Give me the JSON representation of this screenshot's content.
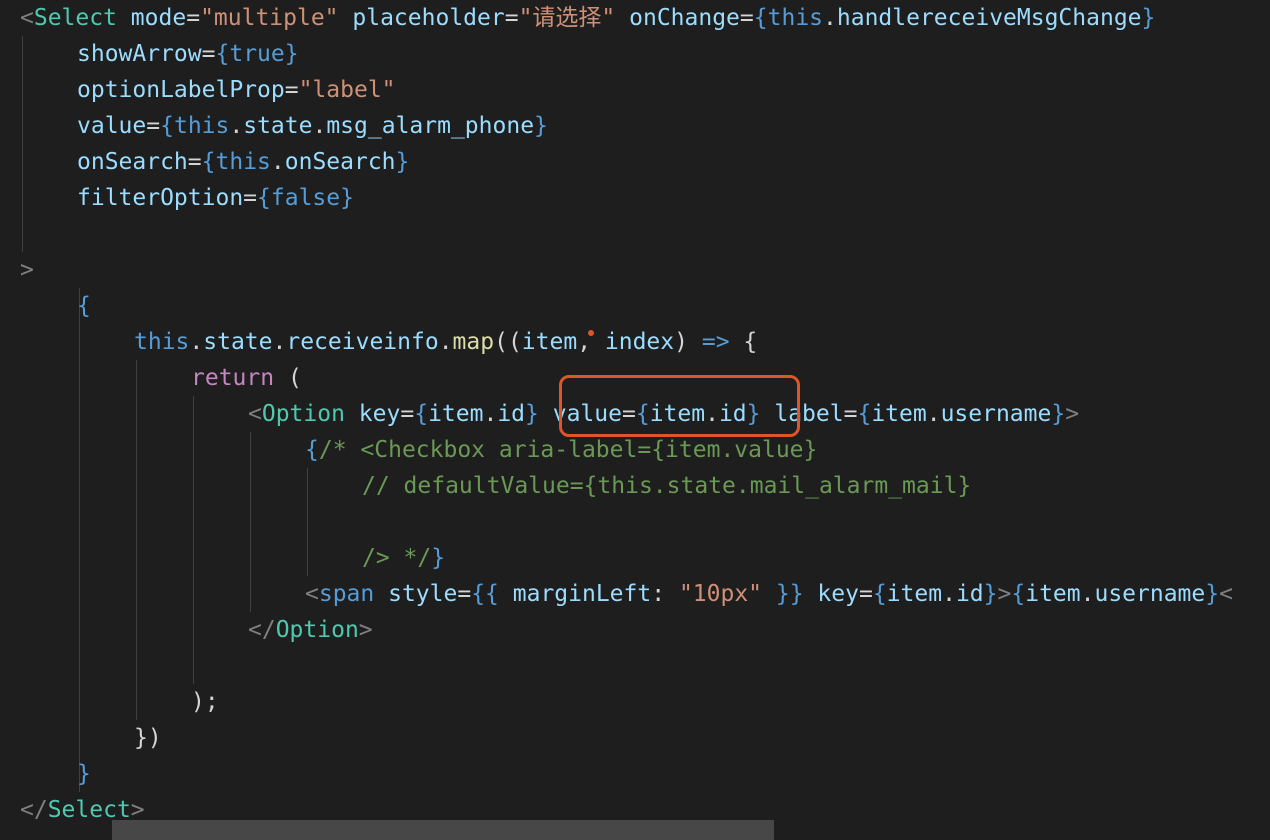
{
  "editor": {
    "lines": [
      {
        "indent": 0,
        "tokens": [
          {
            "t": "<",
            "c": "t-punct"
          },
          {
            "t": "Select",
            "c": "t-tag"
          },
          {
            "t": " mode",
            "c": "t-attr"
          },
          {
            "t": "=",
            "c": "t-op"
          },
          {
            "t": "\"multiple\"",
            "c": "t-str"
          },
          {
            "t": " placeholder",
            "c": "t-attr"
          },
          {
            "t": "=",
            "c": "t-op"
          },
          {
            "t": "\"请选择\"",
            "c": "t-str"
          },
          {
            "t": " onChange",
            "c": "t-attr"
          },
          {
            "t": "=",
            "c": "t-op"
          },
          {
            "t": "{",
            "c": "t-brace"
          },
          {
            "t": "this",
            "c": "t-kw"
          },
          {
            "t": ".",
            "c": "t-text"
          },
          {
            "t": "handlereceiveMsgChange",
            "c": "t-var"
          },
          {
            "t": "}",
            "c": "t-brace"
          }
        ]
      },
      {
        "indent": 1,
        "tokens": [
          {
            "t": "showArrow",
            "c": "t-attr"
          },
          {
            "t": "=",
            "c": "t-op"
          },
          {
            "t": "{",
            "c": "t-brace"
          },
          {
            "t": "true",
            "c": "t-kw"
          },
          {
            "t": "}",
            "c": "t-brace"
          }
        ]
      },
      {
        "indent": 1,
        "tokens": [
          {
            "t": "optionLabelProp",
            "c": "t-attr"
          },
          {
            "t": "=",
            "c": "t-op"
          },
          {
            "t": "\"label\"",
            "c": "t-str"
          }
        ]
      },
      {
        "indent": 1,
        "tokens": [
          {
            "t": "value",
            "c": "t-attr"
          },
          {
            "t": "=",
            "c": "t-op"
          },
          {
            "t": "{",
            "c": "t-brace"
          },
          {
            "t": "this",
            "c": "t-kw"
          },
          {
            "t": ".",
            "c": "t-text"
          },
          {
            "t": "state",
            "c": "t-var"
          },
          {
            "t": ".",
            "c": "t-text"
          },
          {
            "t": "msg_alarm_phone",
            "c": "t-var"
          },
          {
            "t": "}",
            "c": "t-brace"
          }
        ]
      },
      {
        "indent": 1,
        "tokens": [
          {
            "t": "onSearch",
            "c": "t-attr"
          },
          {
            "t": "=",
            "c": "t-op"
          },
          {
            "t": "{",
            "c": "t-brace"
          },
          {
            "t": "this",
            "c": "t-kw"
          },
          {
            "t": ".",
            "c": "t-text"
          },
          {
            "t": "onSearch",
            "c": "t-var"
          },
          {
            "t": "}",
            "c": "t-brace"
          }
        ]
      },
      {
        "indent": 1,
        "tokens": [
          {
            "t": "filterOption",
            "c": "t-attr"
          },
          {
            "t": "=",
            "c": "t-op"
          },
          {
            "t": "{",
            "c": "t-brace"
          },
          {
            "t": "false",
            "c": "t-kw"
          },
          {
            "t": "}",
            "c": "t-brace"
          }
        ]
      },
      {
        "indent": 0,
        "tokens": []
      },
      {
        "indent": 0,
        "tokens": [
          {
            "t": ">",
            "c": "t-punct"
          }
        ]
      },
      {
        "indent": 1,
        "tokens": [
          {
            "t": "{",
            "c": "t-brace"
          }
        ]
      },
      {
        "indent": 2,
        "tokens": [
          {
            "t": "this",
            "c": "t-kw"
          },
          {
            "t": ".",
            "c": "t-text"
          },
          {
            "t": "state",
            "c": "t-var"
          },
          {
            "t": ".",
            "c": "t-text"
          },
          {
            "t": "receiveinfo",
            "c": "t-var"
          },
          {
            "t": ".",
            "c": "t-text"
          },
          {
            "t": "map",
            "c": "t-fn"
          },
          {
            "t": "((",
            "c": "t-text"
          },
          {
            "t": "item",
            "c": "t-var"
          },
          {
            "t": ", ",
            "c": "t-text"
          },
          {
            "t": "index",
            "c": "t-var"
          },
          {
            "t": ") ",
            "c": "t-text"
          },
          {
            "t": "=>",
            "c": "t-kw"
          },
          {
            "t": " {",
            "c": "t-text"
          }
        ]
      },
      {
        "indent": 3,
        "tokens": [
          {
            "t": "return",
            "c": "t-ctrl"
          },
          {
            "t": " (",
            "c": "t-text"
          }
        ]
      },
      {
        "indent": 4,
        "tokens": [
          {
            "t": "<",
            "c": "t-punct"
          },
          {
            "t": "Option",
            "c": "t-tag"
          },
          {
            "t": " key",
            "c": "t-attr"
          },
          {
            "t": "=",
            "c": "t-op"
          },
          {
            "t": "{",
            "c": "t-brace"
          },
          {
            "t": "item",
            "c": "t-var"
          },
          {
            "t": ".",
            "c": "t-text"
          },
          {
            "t": "id",
            "c": "t-var"
          },
          {
            "t": "}",
            "c": "t-brace"
          },
          {
            "t": " value",
            "c": "t-attr"
          },
          {
            "t": "=",
            "c": "t-op"
          },
          {
            "t": "{",
            "c": "t-brace"
          },
          {
            "t": "item",
            "c": "t-var"
          },
          {
            "t": ".",
            "c": "t-text"
          },
          {
            "t": "id",
            "c": "t-var"
          },
          {
            "t": "}",
            "c": "t-brace"
          },
          {
            "t": " label",
            "c": "t-attr"
          },
          {
            "t": "=",
            "c": "t-op"
          },
          {
            "t": "{",
            "c": "t-brace"
          },
          {
            "t": "item",
            "c": "t-var"
          },
          {
            "t": ".",
            "c": "t-text"
          },
          {
            "t": "username",
            "c": "t-var"
          },
          {
            "t": "}",
            "c": "t-brace"
          },
          {
            "t": ">",
            "c": "t-punct"
          }
        ]
      },
      {
        "indent": 5,
        "tokens": [
          {
            "t": "{",
            "c": "t-brace"
          },
          {
            "t": "/* <Checkbox aria-label={item.value}",
            "c": "t-comment"
          }
        ]
      },
      {
        "indent": 6,
        "tokens": [
          {
            "t": "// defaultValue={this.state.mail_alarm_mail}",
            "c": "t-comment"
          }
        ]
      },
      {
        "indent": 0,
        "tokens": []
      },
      {
        "indent": 6,
        "tokens": [
          {
            "t": "/> */",
            "c": "t-comment"
          },
          {
            "t": "}",
            "c": "t-brace"
          }
        ]
      },
      {
        "indent": 5,
        "tokens": [
          {
            "t": "<",
            "c": "t-punct"
          },
          {
            "t": "span",
            "c": "t-kw"
          },
          {
            "t": " style",
            "c": "t-attr"
          },
          {
            "t": "=",
            "c": "t-op"
          },
          {
            "t": "{{",
            "c": "t-brace"
          },
          {
            "t": " marginLeft",
            "c": "t-var"
          },
          {
            "t": ": ",
            "c": "t-text"
          },
          {
            "t": "\"10px\"",
            "c": "t-str"
          },
          {
            "t": " }}",
            "c": "t-brace"
          },
          {
            "t": " key",
            "c": "t-attr"
          },
          {
            "t": "=",
            "c": "t-op"
          },
          {
            "t": "{",
            "c": "t-brace"
          },
          {
            "t": "item",
            "c": "t-var"
          },
          {
            "t": ".",
            "c": "t-text"
          },
          {
            "t": "id",
            "c": "t-var"
          },
          {
            "t": "}",
            "c": "t-brace"
          },
          {
            "t": ">",
            "c": "t-punct"
          },
          {
            "t": "{",
            "c": "t-brace"
          },
          {
            "t": "item",
            "c": "t-var"
          },
          {
            "t": ".",
            "c": "t-text"
          },
          {
            "t": "username",
            "c": "t-var"
          },
          {
            "t": "}",
            "c": "t-brace"
          },
          {
            "t": "<",
            "c": "t-punct"
          }
        ]
      },
      {
        "indent": 4,
        "tokens": [
          {
            "t": "</",
            "c": "t-punct"
          },
          {
            "t": "Option",
            "c": "t-tag"
          },
          {
            "t": ">",
            "c": "t-punct"
          }
        ]
      },
      {
        "indent": 0,
        "tokens": []
      },
      {
        "indent": 3,
        "tokens": [
          {
            "t": ");",
            "c": "t-text"
          }
        ]
      },
      {
        "indent": 2,
        "tokens": [
          {
            "t": "})",
            "c": "t-text"
          }
        ]
      },
      {
        "indent": 1,
        "tokens": [
          {
            "t": "}",
            "c": "t-brace"
          }
        ]
      },
      {
        "indent": 0,
        "tokens": [
          {
            "t": "</",
            "c": "t-punct"
          },
          {
            "t": "Select",
            "c": "t-tag"
          },
          {
            "t": ">",
            "c": "t-punct"
          }
        ]
      }
    ]
  },
  "colors": {
    "background": "#1e1e1e",
    "highlight_box": "#e0542a"
  }
}
